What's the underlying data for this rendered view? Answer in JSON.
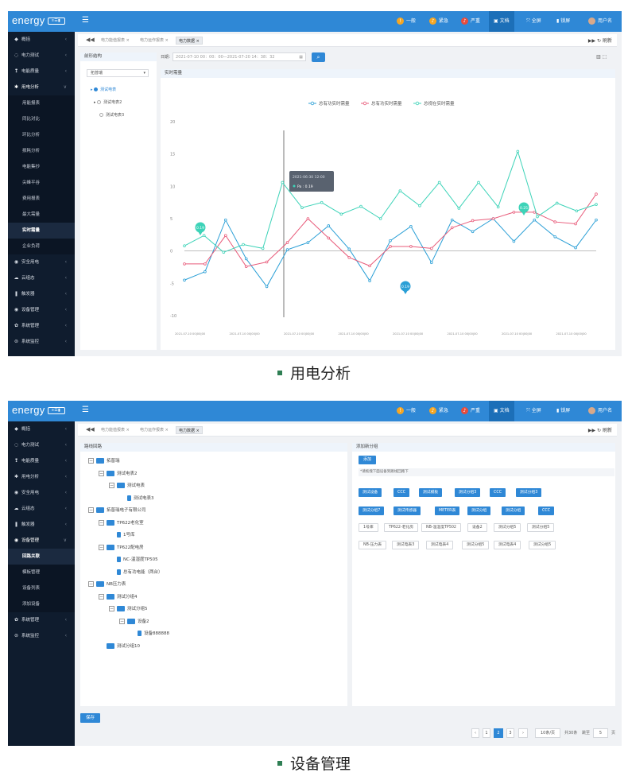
{
  "screen1": {
    "brand": "energy",
    "brand_badge": "≡☰▮",
    "menu_icon": "☰",
    "topbar": [
      {
        "label": "一般",
        "icon": "info-icon",
        "color": "#f5a623"
      },
      {
        "label": "紧急",
        "icon": "bell-icon",
        "color": "#f5a623"
      },
      {
        "label": "严重",
        "icon": "bell-icon",
        "color": "#e74c3c"
      },
      {
        "label": "文档",
        "icon": "doc-icon",
        "color": "#ffffff"
      },
      {
        "label": "全屏",
        "icon": "fullscreen-icon",
        "color": "#ffffff"
      },
      {
        "label": "锁屏",
        "icon": "lock-icon",
        "color": "#ffffff"
      },
      {
        "label": "用户名",
        "icon": "avatar",
        "color": "#ffffff"
      }
    ],
    "sidebar": [
      {
        "label": "概括",
        "icon": "◆",
        "type": "top",
        "chev": "‹"
      },
      {
        "label": "电力测试",
        "icon": "◌",
        "type": "top",
        "chev": "‹"
      },
      {
        "label": "电能质量",
        "icon": "❢",
        "type": "top",
        "chev": "‹"
      },
      {
        "label": "用电分析",
        "icon": "✱",
        "type": "open",
        "chev": "∨"
      },
      {
        "label": "用能报表",
        "type": "sub"
      },
      {
        "label": "同比对比",
        "type": "sub"
      },
      {
        "label": "环比分析",
        "type": "sub"
      },
      {
        "label": "损耗分析",
        "type": "sub"
      },
      {
        "label": "电能集抄",
        "type": "sub"
      },
      {
        "label": "尖峰平谷",
        "type": "sub"
      },
      {
        "label": "费用报表",
        "type": "sub"
      },
      {
        "label": "最大需量",
        "type": "sub"
      },
      {
        "label": "实时需量",
        "type": "sub-active"
      },
      {
        "label": "企业负荷",
        "type": "sub"
      },
      {
        "label": "安全用电",
        "icon": "◉",
        "type": "top",
        "chev": "‹"
      },
      {
        "label": "云组态",
        "icon": "☁",
        "type": "top",
        "chev": "‹"
      },
      {
        "label": "触发器",
        "icon": "❚",
        "type": "top",
        "chev": "‹"
      },
      {
        "label": "设备管理",
        "icon": "◉",
        "type": "top",
        "chev": "‹"
      },
      {
        "label": "系统管理",
        "icon": "✿",
        "type": "top",
        "chev": "‹"
      },
      {
        "label": "系统监控",
        "icon": "⊜",
        "type": "top",
        "chev": "‹"
      }
    ],
    "tab_prev": "◀◀",
    "tabs": [
      {
        "label": "电力能值报表 ×",
        "active": false
      },
      {
        "label": "电力运作报表 ×",
        "active": false
      },
      {
        "label": "电力数据 ×",
        "active": true
      }
    ],
    "tab_right": "▶▶  ↻ 刷新",
    "left_panel_title": "前形结构",
    "select_value": "拓普瑞",
    "select_arrow": "▾",
    "tree": [
      {
        "label": "测试电表",
        "checked": true,
        "level": 1,
        "arrow": "▸",
        "blue": true
      },
      {
        "label": "测试电表2",
        "checked": false,
        "level": 1,
        "arrow": "▸",
        "blue": false
      },
      {
        "label": "测试电表3",
        "checked": false,
        "level": 1,
        "arrow": "",
        "blue": false
      }
    ],
    "date_label": "日期：",
    "date_value": "2021-07-10 00：00：00—2021-07-20 14：38：32",
    "calendar_icon": "▦",
    "search_icon": "⌕",
    "tool_icons": "▥  ⬚",
    "chart_title": "实时需量",
    "tooltip_time": "2021-06-30 12:00",
    "tooltip_value": "Pa : 0.19",
    "marker_labels": [
      "0.19",
      "0.19",
      "0.25"
    ],
    "chart_data": {
      "type": "line",
      "ylim": [
        -10,
        20
      ],
      "yticks": [
        -10,
        -5,
        0,
        5,
        10,
        15,
        20
      ],
      "xtick_label": "2021-07-10 00|00|00",
      "xtick_count": 8,
      "grid": false,
      "legend_position": "top-center",
      "series": [
        {
          "name": "总有功实时需量",
          "color": "#2a9fd6",
          "values": [
            -4.5,
            -3.2,
            4.8,
            -1.2,
            -5.5,
            0.2,
            1.3,
            3.9,
            0.3,
            -4.6,
            1.6,
            3.8,
            -1.8,
            4.8,
            3,
            5,
            1.5,
            4.8,
            2.2,
            0.5,
            4.8
          ]
        },
        {
          "name": "总有功实时需量",
          "color": "#e85b7a",
          "values": [
            -2,
            -2,
            2.4,
            -2.4,
            -1.7,
            1.3,
            5,
            2,
            -1,
            -2.3,
            0.7,
            0.7,
            0.4,
            3.6,
            4.7,
            5,
            6,
            6,
            4.5,
            4.2,
            8.8
          ]
        },
        {
          "name": "总视在实时需量",
          "color": "#3dd3b8",
          "values": [
            0.8,
            2.4,
            -0.2,
            1,
            0.4,
            10.6,
            6.7,
            7.5,
            5.7,
            6.9,
            5,
            9.3,
            7,
            10.6,
            6.6,
            10.6,
            6.8,
            15.4,
            5.3,
            7.4,
            6.2,
            7.2
          ]
        }
      ]
    },
    "caption": "用电分析"
  },
  "screen2": {
    "brand": "energy",
    "brand_badge": "≡☰▮",
    "menu_icon": "☰",
    "topbar": [
      {
        "label": "一般",
        "icon": "info-icon",
        "color": "#f5a623"
      },
      {
        "label": "紧急",
        "icon": "bell-icon",
        "color": "#f5a623"
      },
      {
        "label": "严重",
        "icon": "bell-icon",
        "color": "#e74c3c"
      },
      {
        "label": "文档",
        "icon": "doc-icon",
        "color": "#ffffff"
      },
      {
        "label": "全屏",
        "icon": "fullscreen-icon",
        "color": "#ffffff"
      },
      {
        "label": "锁屏",
        "icon": "lock-icon",
        "color": "#ffffff"
      },
      {
        "label": "用户名",
        "icon": "avatar",
        "color": "#ffffff"
      }
    ],
    "sidebar": [
      {
        "label": "概括",
        "icon": "◆",
        "type": "top",
        "chev": "‹"
      },
      {
        "label": "电力测试",
        "icon": "◌",
        "type": "top",
        "chev": "‹"
      },
      {
        "label": "电能质量",
        "icon": "❢",
        "type": "top",
        "chev": "‹"
      },
      {
        "label": "用电分析",
        "icon": "✱",
        "type": "top",
        "chev": "‹"
      },
      {
        "label": "安全用电",
        "icon": "◉",
        "type": "top",
        "chev": "‹"
      },
      {
        "label": "云组态",
        "icon": "☁",
        "type": "top",
        "chev": "‹"
      },
      {
        "label": "触发器",
        "icon": "❚",
        "type": "top",
        "chev": "‹"
      },
      {
        "label": "设备管理",
        "icon": "◉",
        "type": "open",
        "chev": "∨"
      },
      {
        "label": "回路关联",
        "type": "sub-active"
      },
      {
        "label": "模板管理",
        "type": "sub"
      },
      {
        "label": "设备列表",
        "type": "sub"
      },
      {
        "label": "添加设备",
        "type": "sub"
      },
      {
        "label": "系统管理",
        "icon": "✿",
        "type": "top",
        "chev": "‹"
      },
      {
        "label": "系统监控",
        "icon": "⊜",
        "type": "top",
        "chev": "‹"
      }
    ],
    "tab_prev": "◀◀",
    "tabs": [
      {
        "label": "电力能值报表 ×",
        "active": false
      },
      {
        "label": "电力运作报表 ×",
        "active": false
      },
      {
        "label": "电力数据 ×",
        "active": true
      }
    ],
    "tab_right": "▶▶  ↻ 刷新",
    "left_panel_title": "路线回路",
    "right_panel_title": "添加新分组",
    "tree": [
      {
        "label": "拓普瑞",
        "indent": 0,
        "toggle": "−",
        "kind": "folder"
      },
      {
        "label": "测试电表2",
        "indent": 1,
        "toggle": "−",
        "kind": "folder"
      },
      {
        "label": "测试电表",
        "indent": 2,
        "toggle": "−",
        "kind": "folder"
      },
      {
        "label": "测试电表3",
        "indent": 3,
        "toggle": "",
        "kind": "doc"
      },
      {
        "label": "拓普瑞电子有限公司",
        "indent": 0,
        "toggle": "−",
        "kind": "folder"
      },
      {
        "label": "TP622老化室",
        "indent": 1,
        "toggle": "−",
        "kind": "folder"
      },
      {
        "label": "1号库",
        "indent": 2,
        "toggle": "",
        "kind": "doc"
      },
      {
        "label": "TP622配电房",
        "indent": 1,
        "toggle": "−",
        "kind": "folder"
      },
      {
        "label": "NC-温湿度TP505",
        "indent": 2,
        "toggle": "",
        "kind": "doc"
      },
      {
        "label": "总有功电能（两台）",
        "indent": 2,
        "toggle": "",
        "kind": "doc"
      },
      {
        "label": "NB压力表",
        "indent": 0,
        "toggle": "−",
        "kind": "folder"
      },
      {
        "label": "测试分组4",
        "indent": 1,
        "toggle": "−",
        "kind": "folder"
      },
      {
        "label": "测试分组5",
        "indent": 2,
        "toggle": "−",
        "kind": "folder"
      },
      {
        "label": "设备2",
        "indent": 3,
        "toggle": "−",
        "kind": "folder"
      },
      {
        "label": "设备888888",
        "indent": 4,
        "toggle": "",
        "kind": "doc"
      },
      {
        "label": "测试分组10",
        "indent": 1,
        "toggle": "",
        "kind": "folder"
      }
    ],
    "add_label": "添加",
    "hint": "*请拖拽下面设备到路线回路下",
    "chips_blue": [
      [
        "测试设备",
        "CCC",
        "测试模板",
        "测试分组3",
        "CCC",
        "测试分组3"
      ],
      [
        "测试分组7",
        "测试传感器",
        "METER表",
        "测试分组",
        "测试分组",
        "CCC"
      ]
    ],
    "chips_white": [
      [
        "1号库",
        "TP622-老化房",
        "NB-温湿度TP502",
        "设备2",
        "测试分组5",
        "测试分组5"
      ],
      [
        "NB-压力表",
        "测试电表3",
        "测试电表4",
        "测试分组5",
        "测试电表4",
        "测试分组5"
      ]
    ],
    "save_label": "保存",
    "pagination": {
      "prev": "‹",
      "pages": [
        "1",
        "2",
        "3"
      ],
      "current": "2",
      "next": "›",
      "per_page": "10条/页",
      "total": "共30条",
      "goto_label": "跳至",
      "goto_value": "5",
      "goto_suffix": "页"
    },
    "caption": "设备管理"
  }
}
